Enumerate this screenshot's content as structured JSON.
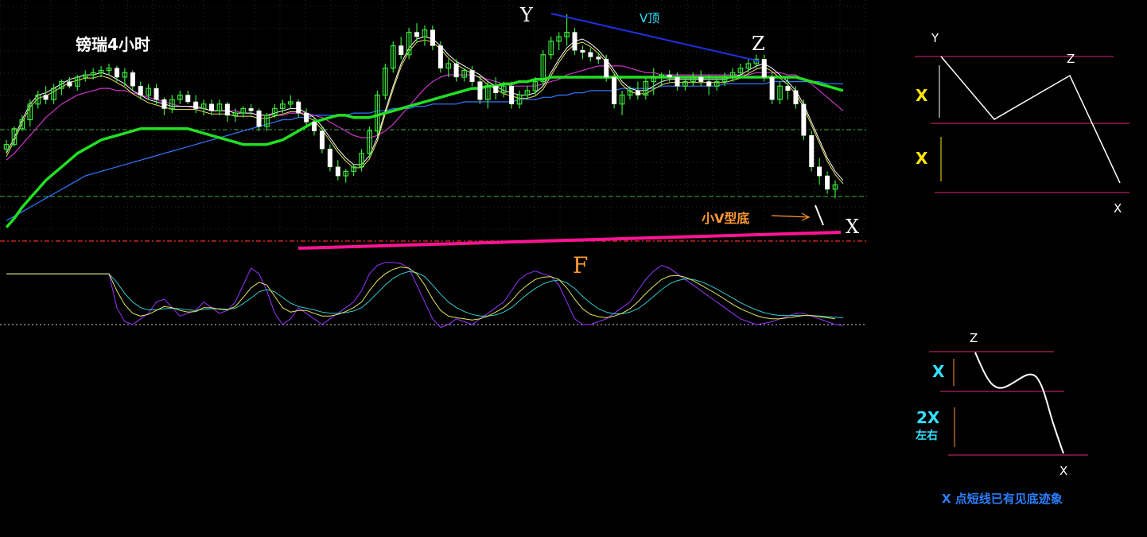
{
  "chart_data": {
    "type": "candlestick",
    "title": "镑瑞4小时",
    "grid": true,
    "y_range": [
      0,
      100
    ],
    "candles": [
      [
        40,
        44,
        38,
        42
      ],
      [
        42,
        50,
        41,
        49
      ],
      [
        49,
        55,
        48,
        53
      ],
      [
        53,
        62,
        50,
        60
      ],
      [
        60,
        66,
        58,
        64
      ],
      [
        64,
        68,
        60,
        62
      ],
      [
        62,
        69,
        60,
        67
      ],
      [
        67,
        71,
        64,
        70
      ],
      [
        70,
        72,
        67,
        68
      ],
      [
        68,
        73,
        66,
        72
      ],
      [
        72,
        75,
        70,
        73
      ],
      [
        73,
        76,
        71,
        74
      ],
      [
        74,
        77,
        72,
        75
      ],
      [
        75,
        78,
        73,
        76
      ],
      [
        76,
        77,
        70,
        72
      ],
      [
        72,
        76,
        68,
        74
      ],
      [
        74,
        75,
        66,
        68
      ],
      [
        68,
        70,
        62,
        64
      ],
      [
        64,
        69,
        62,
        67
      ],
      [
        67,
        69,
        60,
        62
      ],
      [
        62,
        63,
        55,
        58
      ],
      [
        58,
        64,
        56,
        62
      ],
      [
        62,
        66,
        60,
        64
      ],
      [
        64,
        66,
        60,
        61
      ],
      [
        61,
        64,
        56,
        58
      ],
      [
        58,
        62,
        55,
        60
      ],
      [
        60,
        62,
        55,
        57
      ],
      [
        57,
        62,
        55,
        60
      ],
      [
        60,
        61,
        52,
        55
      ],
      [
        55,
        58,
        52,
        56
      ],
      [
        56,
        59,
        54,
        58
      ],
      [
        58,
        60,
        55,
        57
      ],
      [
        57,
        58,
        48,
        50
      ],
      [
        50,
        56,
        48,
        55
      ],
      [
        55,
        60,
        54,
        58
      ],
      [
        58,
        62,
        56,
        60
      ],
      [
        60,
        64,
        58,
        61
      ],
      [
        61,
        62,
        54,
        56
      ],
      [
        56,
        58,
        50,
        52
      ],
      [
        52,
        54,
        46,
        48
      ],
      [
        48,
        50,
        38,
        40
      ],
      [
        40,
        42,
        30,
        32
      ],
      [
        32,
        35,
        26,
        28
      ],
      [
        28,
        31,
        25,
        30
      ],
      [
        30,
        33,
        28,
        32
      ],
      [
        32,
        40,
        30,
        38
      ],
      [
        38,
        50,
        36,
        48
      ],
      [
        48,
        66,
        46,
        64
      ],
      [
        64,
        78,
        62,
        76
      ],
      [
        76,
        88,
        74,
        86
      ],
      [
        86,
        90,
        80,
        82
      ],
      [
        82,
        94,
        80,
        92
      ],
      [
        92,
        96,
        88,
        90
      ],
      [
        90,
        95,
        86,
        93
      ],
      [
        93,
        95,
        84,
        86
      ],
      [
        86,
        88,
        74,
        76
      ],
      [
        76,
        80,
        72,
        78
      ],
      [
        78,
        80,
        70,
        72
      ],
      [
        72,
        76,
        70,
        75
      ],
      [
        75,
        77,
        68,
        70
      ],
      [
        70,
        73,
        60,
        62
      ],
      [
        62,
        70,
        58,
        68
      ],
      [
        68,
        72,
        62,
        65
      ],
      [
        65,
        70,
        63,
        68
      ],
      [
        68,
        70,
        58,
        60
      ],
      [
        60,
        66,
        58,
        64
      ],
      [
        64,
        68,
        62,
        66
      ],
      [
        66,
        72,
        64,
        70
      ],
      [
        70,
        84,
        68,
        82
      ],
      [
        82,
        90,
        80,
        88
      ],
      [
        88,
        92,
        84,
        90
      ],
      [
        90,
        100,
        86,
        92
      ],
      [
        92,
        94,
        82,
        84
      ],
      [
        84,
        86,
        80,
        83
      ],
      [
        83,
        85,
        79,
        81
      ],
      [
        81,
        83,
        78,
        80
      ],
      [
        80,
        82,
        70,
        72
      ],
      [
        72,
        74,
        58,
        60
      ],
      [
        60,
        66,
        55,
        64
      ],
      [
        64,
        68,
        62,
        66
      ],
      [
        66,
        70,
        62,
        64
      ],
      [
        64,
        72,
        62,
        70
      ],
      [
        70,
        76,
        64,
        72
      ],
      [
        72,
        74,
        68,
        73
      ],
      [
        73,
        75,
        70,
        72
      ],
      [
        72,
        74,
        66,
        68
      ],
      [
        68,
        72,
        66,
        70
      ],
      [
        70,
        74,
        68,
        72
      ],
      [
        72,
        75,
        68,
        70
      ],
      [
        70,
        73,
        64,
        68
      ],
      [
        68,
        72,
        66,
        70
      ],
      [
        70,
        74,
        68,
        72
      ],
      [
        72,
        76,
        70,
        74
      ],
      [
        74,
        78,
        72,
        76
      ],
      [
        76,
        80,
        74,
        78
      ],
      [
        78,
        82,
        76,
        80
      ],
      [
        80,
        82,
        70,
        72
      ],
      [
        72,
        74,
        60,
        62
      ],
      [
        62,
        70,
        60,
        68
      ],
      [
        68,
        72,
        62,
        66
      ],
      [
        66,
        68,
        58,
        60
      ],
      [
        60,
        62,
        44,
        46
      ],
      [
        46,
        48,
        30,
        32
      ],
      [
        32,
        36,
        24,
        28
      ],
      [
        28,
        30,
        20,
        22
      ],
      [
        22,
        26,
        18,
        24
      ]
    ],
    "sma_fast": [
      38,
      45,
      53,
      60,
      64,
      65,
      67,
      69,
      71,
      72,
      73,
      73,
      74,
      73,
      71,
      69,
      66,
      64,
      62,
      61,
      60,
      59,
      59,
      59,
      59,
      58,
      57,
      57,
      57,
      56,
      56,
      56,
      55,
      55,
      56,
      57,
      58,
      58,
      56,
      54,
      50,
      45,
      40,
      36,
      33,
      33,
      37,
      45,
      57,
      68,
      78,
      85,
      89,
      90,
      89,
      86,
      82,
      79,
      77,
      75,
      73,
      70,
      68,
      66,
      65,
      64,
      64,
      65,
      68,
      74,
      80,
      85,
      88,
      89,
      87,
      84,
      80,
      75,
      70,
      67,
      66,
      66,
      68,
      70,
      71,
      71,
      71,
      71,
      71,
      71,
      71,
      71,
      72,
      73,
      75,
      77,
      78,
      76,
      73,
      70,
      66,
      60,
      52,
      44,
      36,
      30,
      26
    ],
    "sma_slow": [
      35,
      38,
      42,
      46,
      50,
      54,
      57,
      60,
      62,
      64,
      65,
      66,
      67,
      67,
      66,
      66,
      65,
      64,
      63,
      62,
      61,
      60,
      59,
      59,
      58,
      58,
      57,
      57,
      57,
      57,
      56,
      56,
      55,
      55,
      55,
      55,
      56,
      56,
      56,
      55,
      54,
      52,
      50,
      48,
      46,
      45,
      45,
      46,
      48,
      51,
      55,
      59,
      63,
      67,
      70,
      72,
      73,
      73,
      73,
      73,
      72,
      71,
      70,
      69,
      68,
      68,
      68,
      68,
      69,
      70,
      71,
      73,
      74,
      75,
      76,
      77,
      77,
      77,
      77,
      76,
      75,
      74,
      74,
      73,
      73,
      73,
      73,
      73,
      73,
      73,
      73,
      73,
      73,
      73,
      73,
      74,
      74,
      74,
      74,
      73,
      73,
      71,
      69,
      66,
      63,
      60,
      57
    ],
    "ma_green": [
      5,
      9,
      14,
      18,
      22,
      26,
      29,
      32,
      35,
      38,
      40,
      42,
      44,
      45,
      46,
      47,
      48,
      49,
      49,
      49,
      49,
      49,
      49,
      49,
      48,
      47,
      46,
      45,
      44,
      43,
      42,
      42,
      42,
      42,
      43,
      44,
      46,
      48,
      50,
      52,
      53,
      54,
      55,
      55,
      54,
      54,
      54,
      55,
      56,
      57,
      58,
      59,
      60,
      61,
      62,
      63,
      64,
      65,
      66,
      67,
      67,
      68,
      68,
      69,
      69,
      70,
      70,
      71,
      71,
      72,
      72,
      72,
      72,
      72,
      72,
      72,
      72,
      72,
      72,
      72,
      72,
      72,
      72,
      72,
      72,
      72,
      72,
      72,
      72,
      72,
      72,
      72,
      72,
      72,
      72,
      72,
      72,
      72,
      72,
      72,
      72,
      71,
      70,
      69,
      68,
      67,
      66
    ],
    "ma_blue": [
      8,
      10,
      12,
      14,
      16,
      18,
      20,
      22,
      24,
      26,
      28,
      29,
      30,
      31,
      32,
      33,
      34,
      35,
      36,
      37,
      38,
      39,
      40,
      41,
      42,
      43,
      44,
      45,
      46,
      47,
      48,
      49,
      50,
      51,
      52,
      53,
      53,
      54,
      54,
      55,
      55,
      55,
      55,
      55,
      56,
      56,
      56,
      57,
      57,
      58,
      58,
      58,
      59,
      59,
      60,
      60,
      60,
      60,
      61,
      61,
      61,
      61,
      61,
      61,
      61,
      62,
      62,
      62,
      63,
      63,
      64,
      64,
      65,
      65,
      66,
      66,
      66,
      66,
      67,
      67,
      67,
      67,
      67,
      68,
      68,
      68,
      68,
      68,
      68,
      68,
      68,
      69,
      69,
      69,
      69,
      69,
      69,
      70,
      70,
      70,
      70,
      70,
      70,
      70,
      69,
      69,
      69
    ],
    "osc_purple": [
      40,
      40,
      40,
      40,
      40,
      40,
      40,
      40,
      40,
      40,
      40,
      40,
      40,
      40,
      -20,
      -45,
      -50,
      -40,
      -30,
      -10,
      -5,
      -20,
      -35,
      -30,
      -25,
      -10,
      -20,
      -30,
      -25,
      -10,
      20,
      50,
      40,
      10,
      -30,
      -50,
      -40,
      -20,
      -30,
      -40,
      -50,
      -40,
      -30,
      -20,
      -10,
      10,
      40,
      55,
      60,
      60,
      58,
      50,
      20,
      -10,
      -40,
      -55,
      -50,
      -40,
      -45,
      -50,
      -40,
      -30,
      -20,
      -10,
      10,
      30,
      40,
      45,
      40,
      35,
      20,
      -10,
      -40,
      -50,
      -50,
      -45,
      -40,
      -30,
      -20,
      -10,
      10,
      30,
      45,
      55,
      50,
      40,
      30,
      20,
      10,
      0,
      -10,
      -20,
      -30,
      -40,
      -45,
      -50,
      -48,
      -45,
      -40,
      -35,
      -30,
      -30,
      -35,
      -40,
      -45,
      -50,
      -52
    ],
    "osc_yellow": [
      40,
      40,
      40,
      40,
      40,
      40,
      40,
      40,
      40,
      40,
      40,
      40,
      40,
      40,
      10,
      -15,
      -30,
      -35,
      -32,
      -25,
      -18,
      -20,
      -25,
      -28,
      -27,
      -20,
      -20,
      -23,
      -24,
      -18,
      -2,
      15,
      25,
      20,
      0,
      -20,
      -28,
      -25,
      -25,
      -30,
      -35,
      -35,
      -32,
      -27,
      -20,
      -10,
      10,
      28,
      40,
      48,
      52,
      50,
      40,
      20,
      -5,
      -25,
      -35,
      -38,
      -40,
      -42,
      -40,
      -35,
      -28,
      -20,
      -8,
      8,
      20,
      30,
      34,
      35,
      30,
      15,
      -5,
      -22,
      -32,
      -36,
      -38,
      -35,
      -30,
      -22,
      -10,
      5,
      18,
      30,
      36,
      37,
      34,
      28,
      20,
      12,
      4,
      -5,
      -14,
      -22,
      -28,
      -34,
      -38,
      -40,
      -40,
      -38,
      -36,
      -34,
      -34,
      -36,
      -38,
      -40
    ],
    "osc_cyan": [
      40,
      40,
      40,
      40,
      40,
      40,
      40,
      40,
      40,
      40,
      40,
      40,
      40,
      40,
      25,
      5,
      -10,
      -20,
      -24,
      -24,
      -22,
      -21,
      -22,
      -24,
      -25,
      -23,
      -22,
      -22,
      -23,
      -21,
      -13,
      -3,
      8,
      12,
      8,
      -2,
      -12,
      -18,
      -21,
      -24,
      -28,
      -30,
      -30,
      -29,
      -26,
      -20,
      -8,
      6,
      20,
      32,
      40,
      44,
      42,
      35,
      20,
      4,
      -10,
      -20,
      -27,
      -32,
      -35,
      -35,
      -33,
      -28,
      -20,
      -8,
      4,
      14,
      22,
      27,
      29,
      24,
      14,
      0,
      -12,
      -22,
      -28,
      -31,
      -31,
      -28,
      -22,
      -12,
      0,
      12,
      22,
      28,
      31,
      30,
      26,
      20,
      13,
      5,
      -3,
      -11,
      -18,
      -24,
      -29,
      -32,
      -34,
      -34,
      -34,
      -34,
      -34,
      -35,
      -36,
      -37,
      -38
    ]
  },
  "labels": {
    "title": "镑瑞4小时",
    "y_point": "Y",
    "z_point": "Z",
    "x_point": "X",
    "v_top": "V顶",
    "small_v_bottom": "小V型底",
    "f_label": "F"
  },
  "diagram_top": {
    "y": "Y",
    "z": "Z",
    "x_bottom": "X",
    "x_measure_1": "X",
    "x_measure_2": "X"
  },
  "diagram_bottom": {
    "z": "Z",
    "x_bottom": "X",
    "x_measure": "X",
    "two_x": "2X",
    "left_right": "左右",
    "note": "X 点短线已有见底迹象"
  },
  "colors": {
    "background": "#000000",
    "candle_body": "#ffffff",
    "candle_wick": "#39e639",
    "ma_green": "#22e022",
    "ma_white": "#ffffff",
    "ma_yellow": "#e6e65c",
    "ma_purple": "#cc33cc",
    "ma_blue": "#3377ff",
    "support_line": "#ff1493",
    "v_top_line": "#1f2fe0",
    "accent_orange": "#ff9933",
    "accent_yellow": "#ffe600",
    "accent_cyan": "#33e0ff",
    "grid": "#2a2a2a",
    "dashed_green": "#3fae3f",
    "dashed_red": "#cc2222",
    "guide_pink": "#e0287a",
    "note_blue": "#2a7fff"
  }
}
